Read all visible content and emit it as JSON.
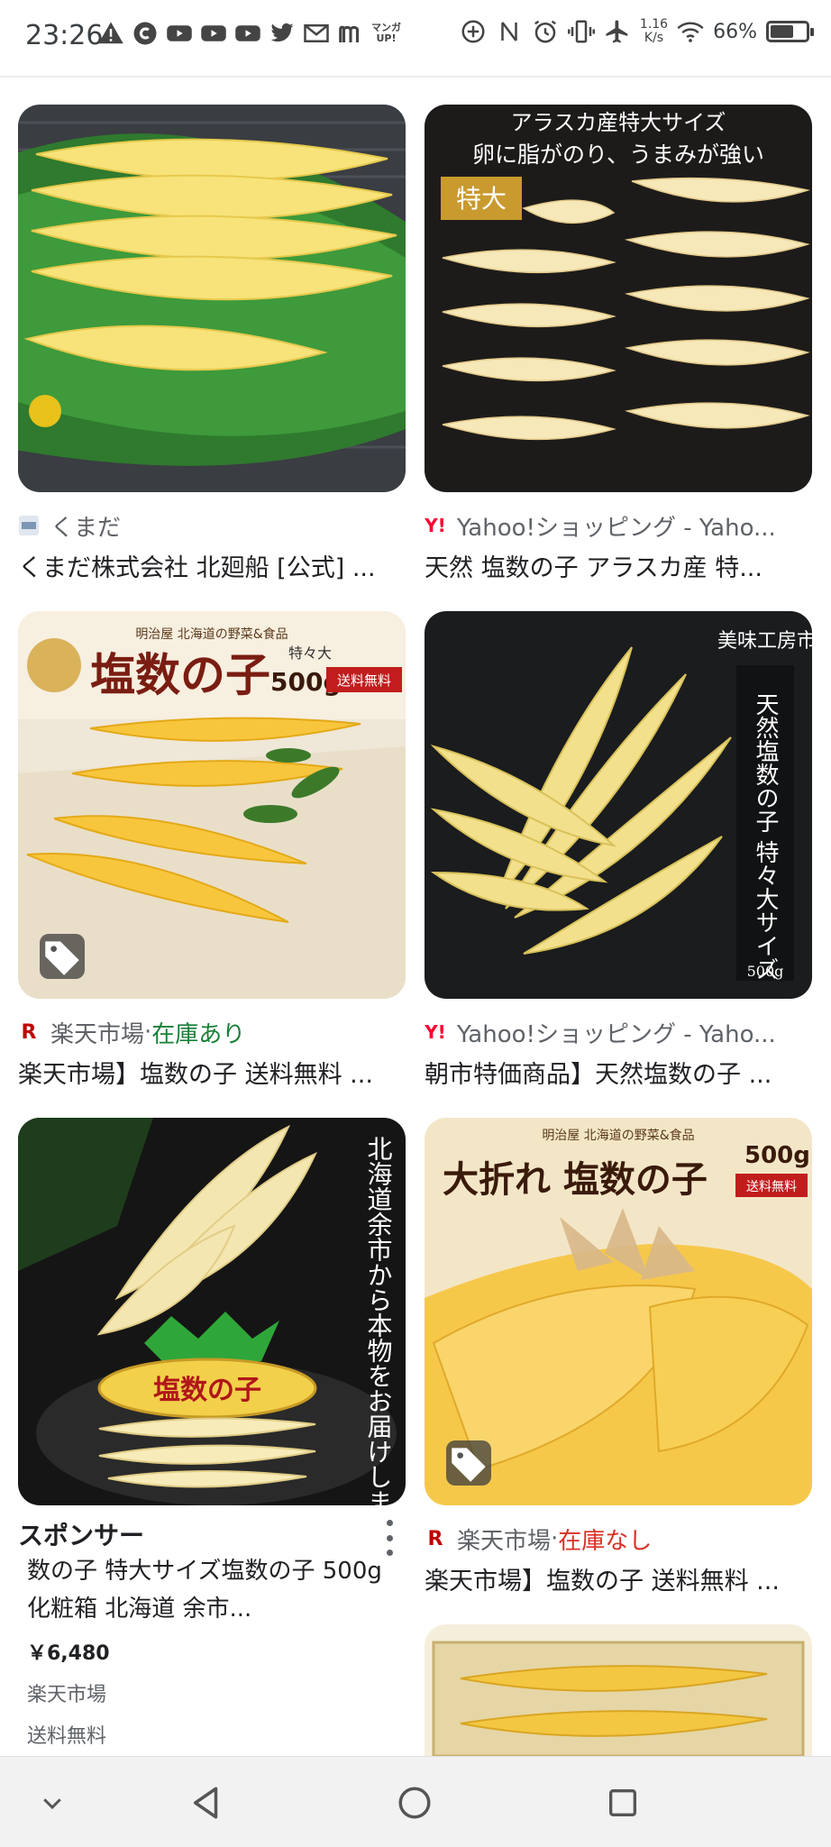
{
  "status_bar": {
    "time": "23:26",
    "net_speed_value": "1.16",
    "net_speed_unit": "K/s",
    "battery_percent": "66%",
    "battery_level": 0.66,
    "manga_label_1": "マンガ",
    "manga_label_2": "UP!"
  },
  "results": [
    {
      "source": "くまだ",
      "title": "くまだ株式会社 北廻船 [公式] ...",
      "stock": ""
    },
    {
      "source": "Yahoo!ショッピング - Yaho...",
      "title": "天然 塩数の子 アラスカ産 特...",
      "stock": "",
      "image_text": {
        "line1": "アラスカ産特大サイズ",
        "line2": "卵に脂がのり、うまみが強い",
        "badge": "特大"
      }
    },
    {
      "source": "楽天市場",
      "stock_sep": " · ",
      "stock": "在庫あり",
      "title": "楽天市場】塩数の子 送料無料 ...",
      "image_text": {
        "top": "明治屋 北海道の野菜&食品",
        "main": "塩数の子",
        "size": "特々大",
        "weight": "500g",
        "ship": "送料無料"
      }
    },
    {
      "source": "Yahoo!ショッピング - Yaho...",
      "title": "朝市特価商品】天然塩数の子 ...",
      "stock": "",
      "image_text": {
        "brand": "美味工房市",
        "vertical": "天然塩数の子 特々大サイズ",
        "weight": "500g"
      }
    },
    {
      "label": "スポンサー",
      "desc": "数の子 特大サイズ塩数の子 500g 化粧箱 北海道 余市...",
      "price": "￥6,480",
      "merchant": "楽天市場",
      "shipping": "送料無料",
      "image_text": {
        "vertical": "北海道余市から本物をお届けします。",
        "box": "塩数の子"
      }
    },
    {
      "source": "楽天市場",
      "stock_sep": " · ",
      "stock": "在庫なし",
      "title": "楽天市場】塩数の子 送料無料 ...",
      "image_text": {
        "top": "明治屋 北海道の野菜&食品",
        "main": "大折れ 塩数の子",
        "weight": "500g",
        "ship": "送料無料"
      }
    }
  ],
  "colors": {
    "in_stock": "#188038",
    "out_of_stock": "#d93025",
    "yahoo": "#ff0033",
    "rakuten": "#bf0000"
  },
  "icons": [
    "warning-icon",
    "c-app-icon",
    "youtube-icon",
    "twitter-icon",
    "gmail-icon",
    "m-app-icon",
    "add-circle-icon",
    "nfc-icon",
    "alarm-icon",
    "vibrate-icon",
    "airplane-icon",
    "wifi-icon",
    "battery-icon",
    "tag-icon",
    "more-vert-icon",
    "chevron-down-icon",
    "back-icon",
    "home-icon",
    "recents-icon"
  ]
}
